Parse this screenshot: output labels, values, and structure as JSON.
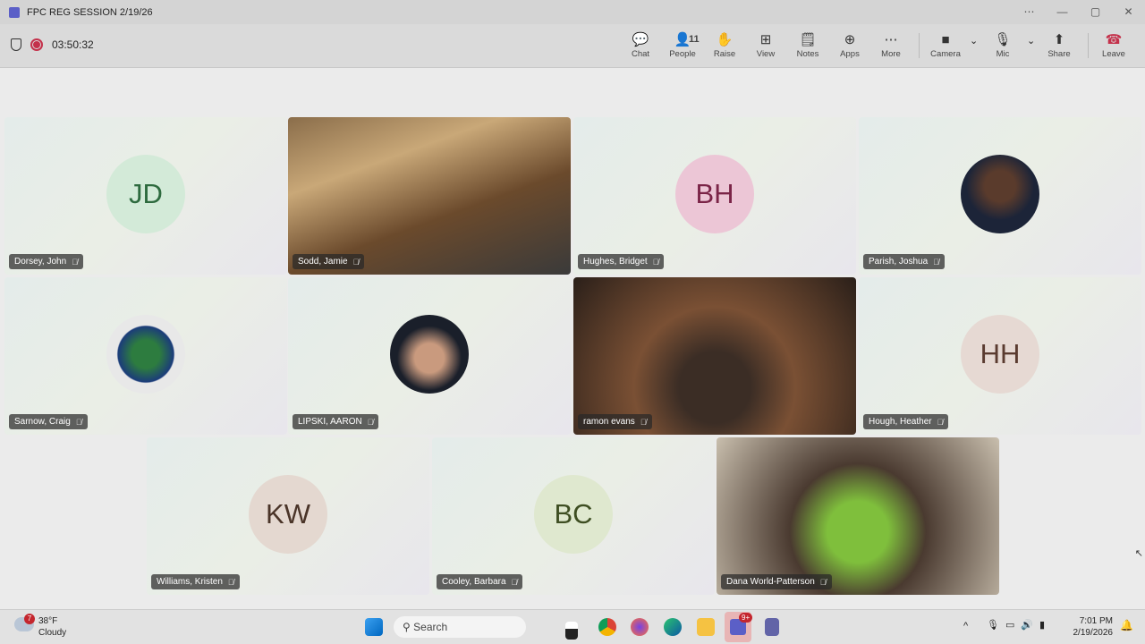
{
  "window": {
    "title": "FPC REG SESSION 2/19/26",
    "controls": [
      "⋯",
      "—",
      "▢",
      "✕"
    ]
  },
  "meeting": {
    "timer": "03:50:32"
  },
  "toolbar": [
    {
      "label": "Chat",
      "icon": "chat-icon",
      "glyph": "💬"
    },
    {
      "label": "People",
      "icon": "people-icon",
      "glyph": "👤",
      "count": "11"
    },
    {
      "label": "Raise",
      "icon": "hand-icon",
      "glyph": "✋"
    },
    {
      "label": "View",
      "icon": "grid-icon",
      "glyph": "⊞"
    },
    {
      "label": "Notes",
      "icon": "notes-icon",
      "glyph": "🗒"
    },
    {
      "label": "Apps",
      "icon": "apps-icon",
      "glyph": "⊕"
    },
    {
      "label": "More",
      "icon": "more-icon",
      "glyph": "⋯"
    },
    {
      "label": "Camera",
      "icon": "camera-off-icon",
      "glyph": "■"
    },
    {
      "label": "Mic",
      "icon": "mic-off-icon",
      "glyph": "🎙"
    },
    {
      "label": "Share",
      "icon": "share-icon",
      "glyph": "⬆"
    },
    {
      "label": "Leave",
      "icon": "phone-hangup-icon",
      "glyph": "☎"
    }
  ],
  "participants": [
    {
      "name": "Dorsey, John",
      "initials": "JD",
      "bg": "#d3ead8",
      "fg": "#2d6a3e"
    },
    {
      "name": "Sodd, Jamie",
      "video": true
    },
    {
      "name": "Hughes, Bridget",
      "initials": "BH",
      "bg": "#ecc6d6",
      "fg": "#7a2447"
    },
    {
      "name": "Parish, Joshua",
      "photo": true
    },
    {
      "name": "Sarnow, Craig",
      "photo": true
    },
    {
      "name": "LIPSKI, AARON",
      "photo": true
    },
    {
      "name": "ramon evans",
      "video": true
    },
    {
      "name": "Hough, Heather",
      "initials": "HH",
      "bg": "#e6d9d3",
      "fg": "#5a3b30"
    },
    {
      "name": "Williams, Kristen",
      "initials": "KW",
      "bg": "#e4d8d0",
      "fg": "#4a3428"
    },
    {
      "name": "Cooley, Barbara",
      "initials": "BC",
      "bg": "#dfe8cf",
      "fg": "#3e4e22"
    },
    {
      "name": "Dana World-Patterson",
      "video": true
    }
  ],
  "taskbar": {
    "weather_temp": "38°F",
    "weather_desc": "Cloudy",
    "weather_badge": "7",
    "search": "Search",
    "teams_badge": "9+",
    "time": "7:01 PM",
    "date": "2/19/2026"
  }
}
